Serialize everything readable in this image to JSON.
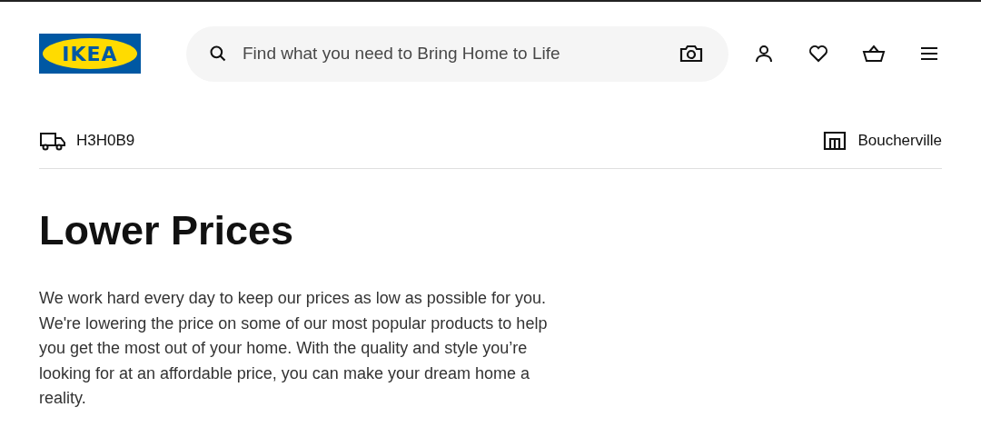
{
  "header": {
    "logo": "IKEA",
    "search": {
      "placeholder": "Find what you need to Bring Home to Life"
    }
  },
  "location_bar": {
    "postal_code": "H3H0B9",
    "store": "Boucherville"
  },
  "heading": "Lower Prices",
  "intro": "We work hard every day to keep our prices as low as possible for you. We're lowering the price on some of our most popular products to help you get the most out of your home. With the quality and style you’re looking for at an affordable price, you can make your dream home a reality."
}
